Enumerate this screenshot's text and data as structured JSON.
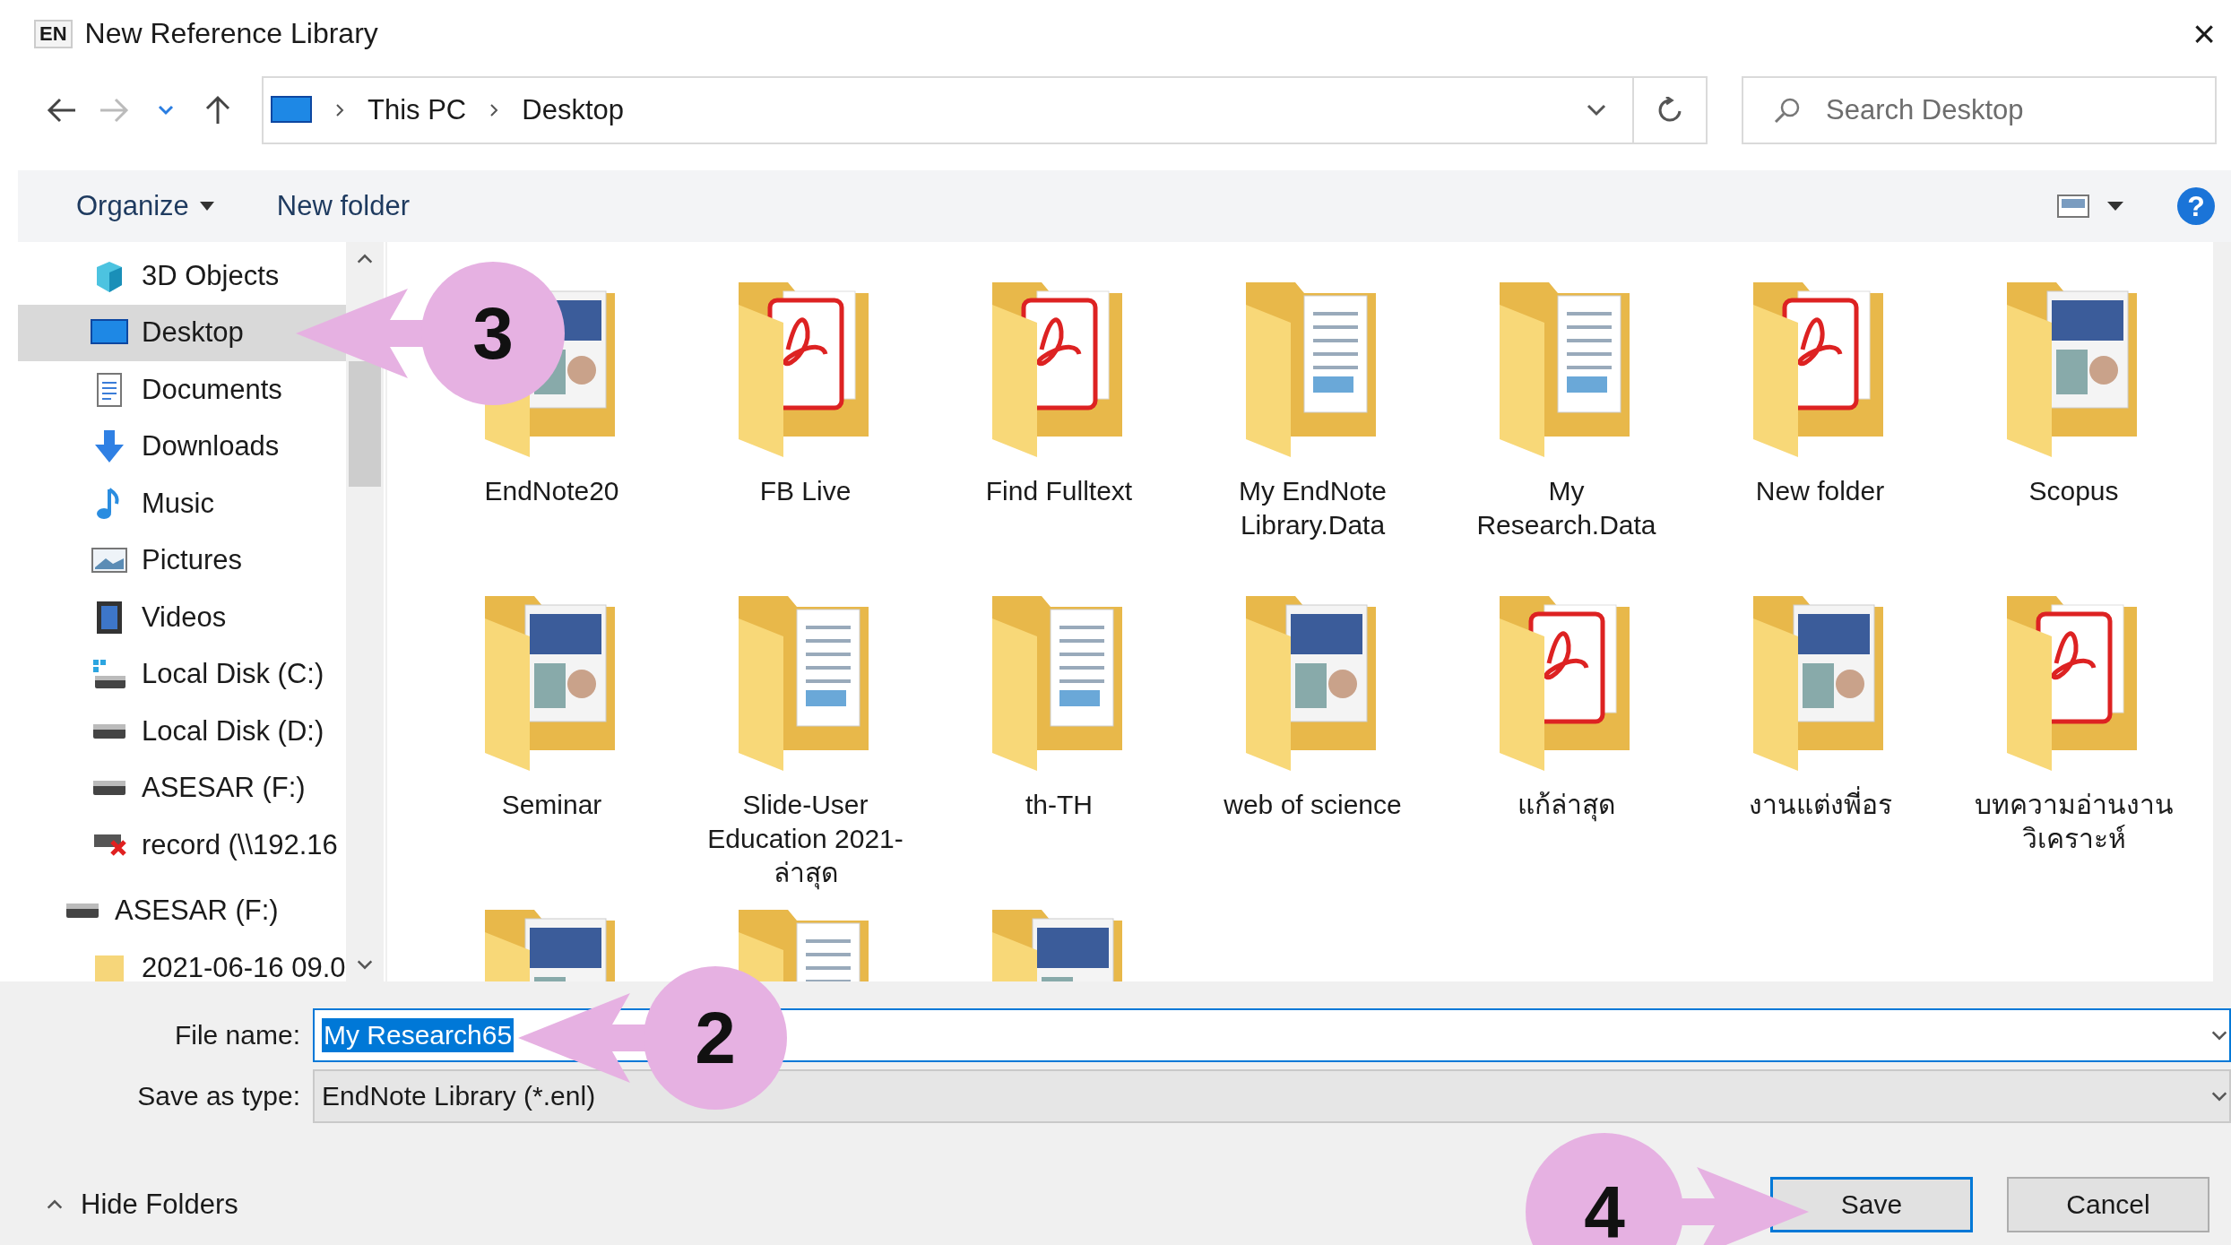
{
  "window": {
    "badge": "EN",
    "title": "New Reference Library",
    "close": "×"
  },
  "address": {
    "path": [
      "This PC",
      "Desktop"
    ],
    "search_placeholder": "Search Desktop"
  },
  "toolbar": {
    "organize": "Organize",
    "new_folder": "New folder",
    "help": "?"
  },
  "sidebar": {
    "items": [
      {
        "label": "3D Objects",
        "kind": "cube",
        "selected": false
      },
      {
        "label": "Desktop",
        "kind": "desktop",
        "selected": true
      },
      {
        "label": "Documents",
        "kind": "documents",
        "selected": false
      },
      {
        "label": "Downloads",
        "kind": "downloads",
        "selected": false
      },
      {
        "label": "Music",
        "kind": "music",
        "selected": false
      },
      {
        "label": "Pictures",
        "kind": "pictures",
        "selected": false
      },
      {
        "label": "Videos",
        "kind": "videos",
        "selected": false
      },
      {
        "label": "Local Disk (C:)",
        "kind": "system-disk",
        "selected": false
      },
      {
        "label": "Local Disk (D:)",
        "kind": "disk",
        "selected": false
      },
      {
        "label": "ASESAR (F:)",
        "kind": "disk",
        "selected": false
      },
      {
        "label": "record (\\\\192.16",
        "kind": "network-off",
        "selected": false
      },
      {
        "label": "ASESAR (F:)",
        "kind": "disk",
        "selected": false,
        "children": [
          {
            "label": "2021-06-16 09.0",
            "kind": "folder",
            "selected": false
          }
        ]
      }
    ]
  },
  "files": [
    {
      "label": "EndNote20",
      "kind": "photo"
    },
    {
      "label": "FB Live",
      "kind": "pdf"
    },
    {
      "label": "Find Fulltext",
      "kind": "pdf"
    },
    {
      "label": "My EndNote Library.Data",
      "kind": "doc"
    },
    {
      "label": "My Research.Data",
      "kind": "doc"
    },
    {
      "label": "New folder",
      "kind": "pdf"
    },
    {
      "label": "Scopus",
      "kind": "photo"
    },
    {
      "label": "Seminar",
      "kind": "photo"
    },
    {
      "label": "Slide-User Education 2021-ล่าสุด",
      "kind": "doc"
    },
    {
      "label": "th-TH",
      "kind": "doc"
    },
    {
      "label": "web of science",
      "kind": "photo"
    },
    {
      "label": "แก้ล่าสุด",
      "kind": "pdf"
    },
    {
      "label": "งานแต่งพี่อร",
      "kind": "photo"
    },
    {
      "label": "บทความอ่านงานวิเคราะห์",
      "kind": "pdf"
    },
    {
      "kind": "photo"
    },
    {
      "kind": "doc"
    },
    {
      "kind": "photo"
    }
  ],
  "footer": {
    "file_name_label": "File name:",
    "file_name": "My Research65",
    "type_label": "Save as type:",
    "type": "EndNote Library (*.enl)",
    "hide_folders": "Hide Folders",
    "buttons": [
      {
        "label": "Save",
        "default": true
      },
      {
        "label": "Cancel",
        "default": false
      }
    ]
  },
  "callouts": [
    {
      "number": "3",
      "kind": "left"
    },
    {
      "number": "2",
      "kind": "left"
    },
    {
      "number": "4",
      "kind": "right"
    }
  ]
}
